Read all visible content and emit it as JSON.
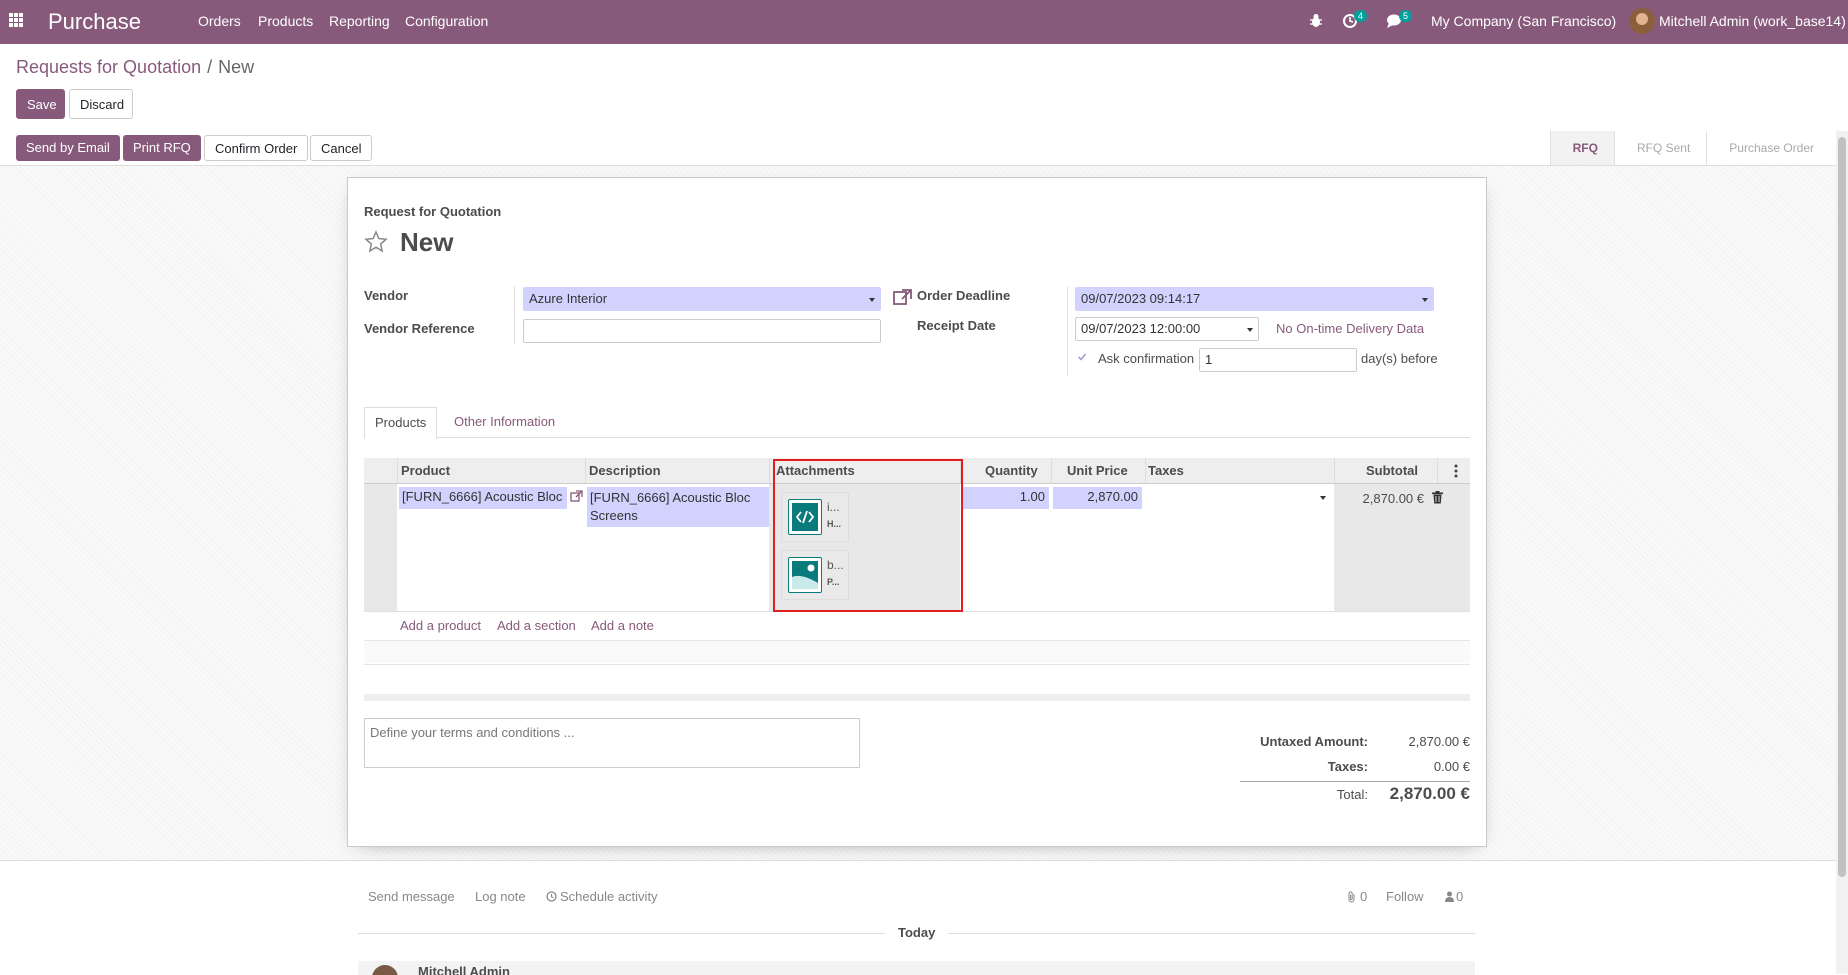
{
  "navbar": {
    "app_name": "Purchase",
    "menu": [
      "Orders",
      "Products",
      "Reporting",
      "Configuration"
    ],
    "activity_count": "4",
    "message_count": "5",
    "company": "My Company (San Francisco)",
    "user": "Mitchell Admin (work_base14)"
  },
  "breadcrumb": {
    "parent": "Requests for Quotation",
    "separator": "/",
    "current": "New"
  },
  "buttons": {
    "save": "Save",
    "discard": "Discard"
  },
  "header_buttons": {
    "send_email": "Send by Email",
    "print_rfq": "Print RFQ",
    "confirm": "Confirm Order",
    "cancel": "Cancel"
  },
  "status_steps": [
    "RFQ",
    "RFQ Sent",
    "Purchase Order"
  ],
  "form": {
    "subtitle": "Request for Quotation",
    "title": "New",
    "vendor_label": "Vendor",
    "vendor_value": "Azure Interior",
    "vendor_ref_label": "Vendor Reference",
    "vendor_ref_value": "",
    "order_deadline_label": "Order Deadline",
    "order_deadline_value": "09/07/2023 09:14:17",
    "receipt_date_label": "Receipt Date",
    "receipt_date_value": "09/07/2023 12:00:00",
    "no_delivery_link": "No On-time Delivery Data",
    "ask_confirmation_label": "Ask confirmation",
    "ask_confirmation_days": "1",
    "days_before": "day(s) before"
  },
  "tabs": [
    "Products",
    "Other Information"
  ],
  "table": {
    "columns": {
      "product": "Product",
      "description": "Description",
      "attachments": "Attachments",
      "quantity": "Quantity",
      "unit_price": "Unit Price",
      "taxes": "Taxes",
      "subtotal": "Subtotal"
    },
    "row": {
      "product": "[FURN_6666] Acoustic Bloc",
      "description_line1": "[FURN_6666] Acoustic Bloc",
      "description_line2": "Screens",
      "attachments": [
        {
          "name": "i...",
          "ext": "H...",
          "icon": "code-file-icon"
        },
        {
          "name": "b...",
          "ext": "P...",
          "icon": "image-file-icon"
        }
      ],
      "quantity": "1.00",
      "unit_price": "2,870.00",
      "subtotal": "2,870.00 €"
    },
    "add_product": "Add a product",
    "add_section": "Add a section",
    "add_note": "Add a note"
  },
  "terms_placeholder": "Define your terms and conditions ...",
  "totals": {
    "untaxed_label": "Untaxed Amount:",
    "untaxed_value": "2,870.00 €",
    "taxes_label": "Taxes:",
    "taxes_value": "0.00 €",
    "total_label": "Total:",
    "total_value": "2,870.00 €"
  },
  "chatter": {
    "send_message": "Send message",
    "log_note": "Log note",
    "schedule_activity": "Schedule activity",
    "attachments_count": "0",
    "follow": "Follow",
    "followers_count": "0",
    "today": "Today",
    "author": "Mitchell Admin"
  },
  "colors": {
    "brand": "#875a7b",
    "required_field": "#d2d2ff",
    "highlight": "#e02020",
    "teal": "#00a09d"
  }
}
